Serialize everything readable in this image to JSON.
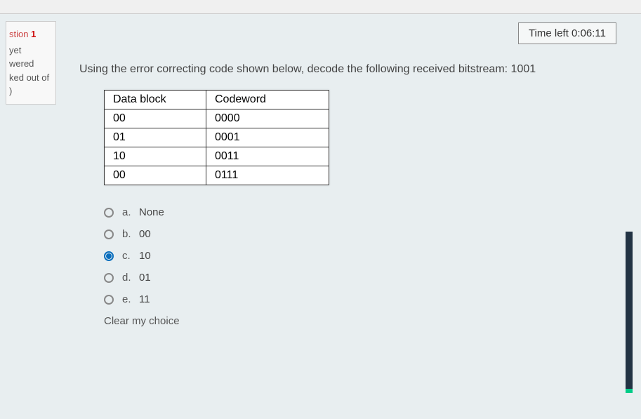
{
  "timer": "Time left 0:06:11",
  "sidebar": {
    "line1_prefix": "stion ",
    "line1_num": "1",
    "line2": "yet",
    "line3": "wered",
    "line4": "ked out of",
    "line5": ")"
  },
  "question": "Using the error correcting code shown below, decode the following received bitstream: 1001",
  "table": {
    "headers": [
      "Data block",
      "Codeword"
    ],
    "rows": [
      [
        "00",
        "0000"
      ],
      [
        "01",
        "0001"
      ],
      [
        "10",
        "0011"
      ],
      [
        "00",
        "0111"
      ]
    ]
  },
  "options": [
    {
      "letter": "a.",
      "text": "None",
      "selected": false
    },
    {
      "letter": "b.",
      "text": "00",
      "selected": false
    },
    {
      "letter": "c.",
      "text": "10",
      "selected": true
    },
    {
      "letter": "d.",
      "text": "01",
      "selected": false
    },
    {
      "letter": "e.",
      "text": "11",
      "selected": false
    }
  ],
  "clear_choice": "Clear my choice"
}
